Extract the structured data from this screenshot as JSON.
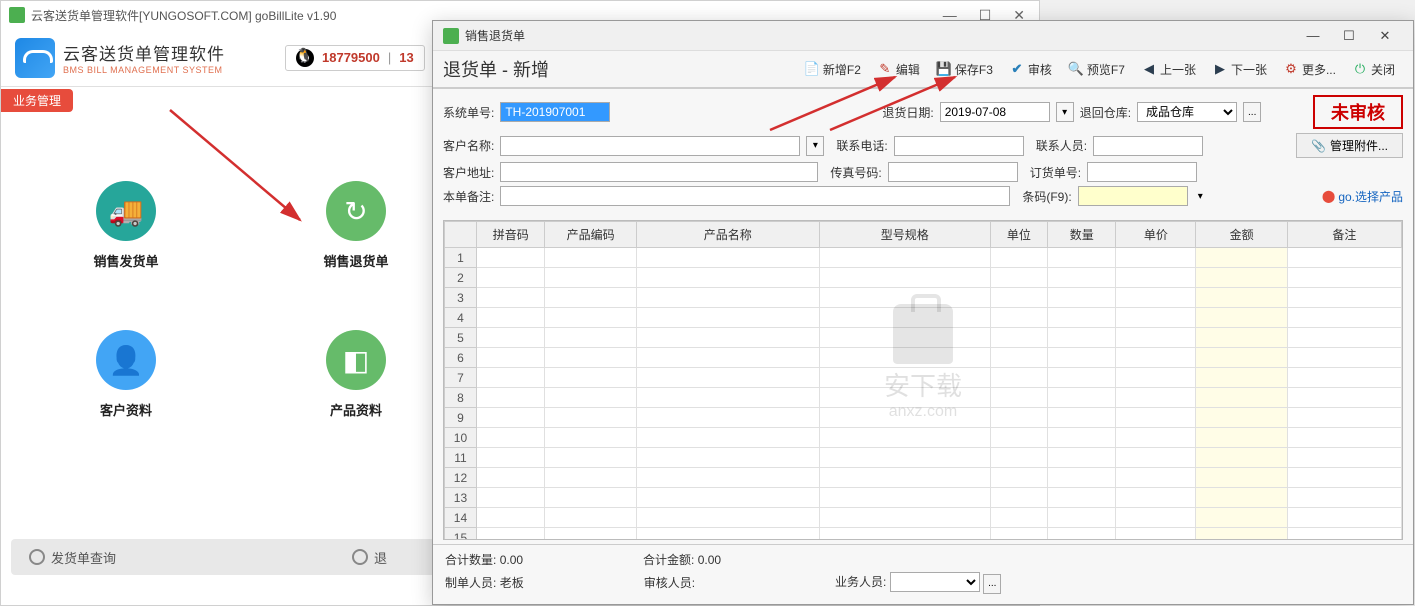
{
  "main_window": {
    "title": "云客送货单管理软件[YUNGOSOFT.COM]  goBillLite v1.90",
    "app_name_cn": "云客送货单管理软件",
    "app_name_en": "BMS BILL MANAGEMENT SYSTEM",
    "qq_number": "18779500",
    "qq_number2": "13",
    "side_tab": "业务管理",
    "icons": {
      "delivery": "销售发货单",
      "return": "销售退货单",
      "customer": "客户资料",
      "product": "产品资料"
    },
    "bottom": {
      "query": "发货单查询",
      "ret": "退"
    }
  },
  "dialog": {
    "title": "销售退货单",
    "heading": "退货单 - 新增",
    "toolbar": {
      "new": "新增F2",
      "edit": "编辑",
      "save": "保存F3",
      "audit": "审核",
      "preview": "预览F7",
      "prev": "上一张",
      "next": "下一张",
      "more": "更多...",
      "close": "关闭"
    },
    "form": {
      "sys_no_label": "系统单号:",
      "sys_no": "TH-201907001",
      "return_date_label": "退货日期:",
      "return_date": "2019-07-08",
      "return_wh_label": "退回仓库:",
      "return_wh": "成品仓库",
      "status": "未审核",
      "customer_label": "客户名称:",
      "phone_label": "联系电话:",
      "contact_label": "联系人员:",
      "attach_btn": "管理附件...",
      "address_label": "客户地址:",
      "fax_label": "传真号码:",
      "order_no_label": "订货单号:",
      "remark_label": "本单备注:",
      "barcode_label": "条码(F9):",
      "go_select": "go.选择产品"
    },
    "grid": {
      "columns": [
        "拼音码",
        "产品编码",
        "产品名称",
        "型号规格",
        "单位",
        "数量",
        "单价",
        "金额",
        "备注"
      ],
      "row_count": 15
    },
    "watermark": {
      "main": "安下载",
      "sub": "anxz.com"
    },
    "footer": {
      "total_qty_label": "合计数量:",
      "total_qty": "0.00",
      "total_amt_label": "合计金额:",
      "total_amt": "0.00",
      "creator_label": "制单人员:",
      "creator": "老板",
      "auditor_label": "审核人员:",
      "biz_label": "业务人员:"
    }
  }
}
